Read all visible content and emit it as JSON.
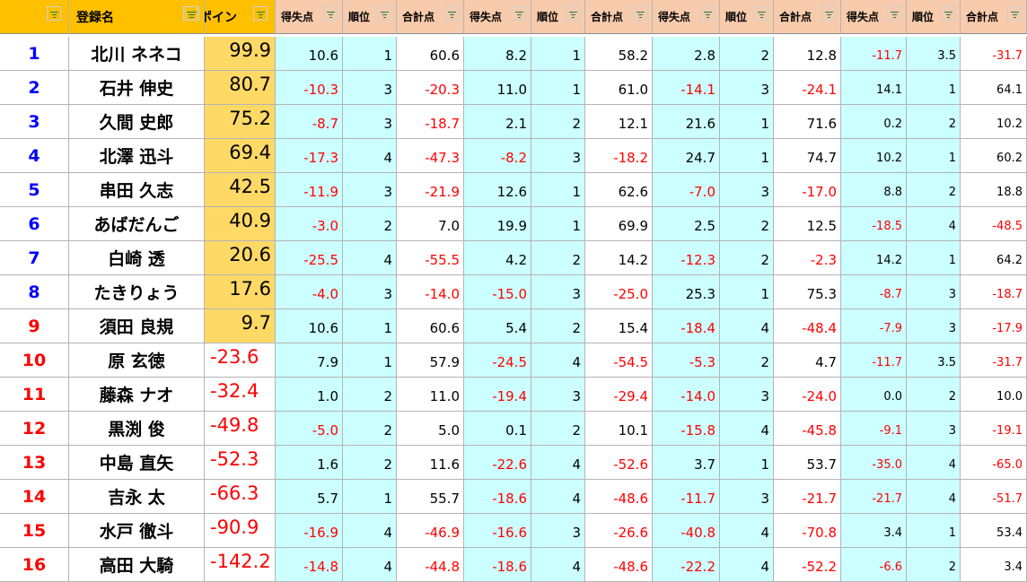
{
  "header": {
    "rank_col": "",
    "name_col": "登録名",
    "points_col": "ポイン",
    "round_cols": [
      "得失点",
      "順位",
      "合計点",
      "得失点",
      "順位",
      "合計点",
      "得失点",
      "順位",
      "合計点",
      "得失点",
      "順位",
      "合計点"
    ]
  },
  "colors": {
    "header_bg": "#f8cbad",
    "header_orange": "#ffc000",
    "points_bg": "#ffd966",
    "cyan_bg": "#ccffff",
    "negative": "#ff0000",
    "rank_blue": "#0000ff",
    "rank_red": "#ff0000"
  },
  "icons": {
    "filter": "filter-dropdown-icon"
  },
  "rows": [
    {
      "rank": "1",
      "name": "北川 ネネコ",
      "points": "99.9",
      "vals": [
        "10.6",
        "1",
        "60.6",
        "8.2",
        "1",
        "58.2",
        "2.8",
        "2",
        "12.8",
        "-11.7",
        "3.5",
        "-31.7"
      ]
    },
    {
      "rank": "2",
      "name": "石井 伸史",
      "points": "80.7",
      "vals": [
        "-10.3",
        "3",
        "-20.3",
        "11.0",
        "1",
        "61.0",
        "-14.1",
        "3",
        "-24.1",
        "14.1",
        "1",
        "64.1"
      ]
    },
    {
      "rank": "3",
      "name": "久間 史郎",
      "points": "75.2",
      "vals": [
        "-8.7",
        "3",
        "-18.7",
        "2.1",
        "2",
        "12.1",
        "21.6",
        "1",
        "71.6",
        "0.2",
        "2",
        "10.2"
      ]
    },
    {
      "rank": "4",
      "name": "北澤 迅斗",
      "points": "69.4",
      "vals": [
        "-17.3",
        "4",
        "-47.3",
        "-8.2",
        "3",
        "-18.2",
        "24.7",
        "1",
        "74.7",
        "10.2",
        "1",
        "60.2"
      ]
    },
    {
      "rank": "5",
      "name": "串田 久志",
      "points": "42.5",
      "vals": [
        "-11.9",
        "3",
        "-21.9",
        "12.6",
        "1",
        "62.6",
        "-7.0",
        "3",
        "-17.0",
        "8.8",
        "2",
        "18.8"
      ]
    },
    {
      "rank": "6",
      "name": "あばだんご",
      "points": "40.9",
      "vals": [
        "-3.0",
        "2",
        "7.0",
        "19.9",
        "1",
        "69.9",
        "2.5",
        "2",
        "12.5",
        "-18.5",
        "4",
        "-48.5"
      ]
    },
    {
      "rank": "7",
      "name": "白崎 透",
      "points": "20.6",
      "vals": [
        "-25.5",
        "4",
        "-55.5",
        "4.2",
        "2",
        "14.2",
        "-12.3",
        "2",
        "-2.3",
        "14.2",
        "1",
        "64.2"
      ]
    },
    {
      "rank": "8",
      "name": "たきりょう",
      "points": "17.6",
      "vals": [
        "-4.0",
        "3",
        "-14.0",
        "-15.0",
        "3",
        "-25.0",
        "25.3",
        "1",
        "75.3",
        "-8.7",
        "3",
        "-18.7"
      ]
    },
    {
      "rank": "9",
      "name": "須田 良規",
      "points": "9.7",
      "vals": [
        "10.6",
        "1",
        "60.6",
        "5.4",
        "2",
        "15.4",
        "-18.4",
        "4",
        "-48.4",
        "-7.9",
        "3",
        "-17.9"
      ]
    },
    {
      "rank": "10",
      "name": "原 玄徳",
      "points": "-23.6",
      "vals": [
        "7.9",
        "1",
        "57.9",
        "-24.5",
        "4",
        "-54.5",
        "-5.3",
        "2",
        "4.7",
        "-11.7",
        "3.5",
        "-31.7"
      ]
    },
    {
      "rank": "11",
      "name": "藤森 ナオ",
      "points": "-32.4",
      "vals": [
        "1.0",
        "2",
        "11.0",
        "-19.4",
        "3",
        "-29.4",
        "-14.0",
        "3",
        "-24.0",
        "0.0",
        "2",
        "10.0"
      ]
    },
    {
      "rank": "12",
      "name": "黒渕 俊",
      "points": "-49.8",
      "vals": [
        "-5.0",
        "2",
        "5.0",
        "0.1",
        "2",
        "10.1",
        "-15.8",
        "4",
        "-45.8",
        "-9.1",
        "3",
        "-19.1"
      ]
    },
    {
      "rank": "13",
      "name": "中島 直矢",
      "points": "-52.3",
      "vals": [
        "1.6",
        "2",
        "11.6",
        "-22.6",
        "4",
        "-52.6",
        "3.7",
        "1",
        "53.7",
        "-35.0",
        "4",
        "-65.0"
      ]
    },
    {
      "rank": "14",
      "name": "吉永 太",
      "points": "-66.3",
      "vals": [
        "5.7",
        "1",
        "55.7",
        "-18.6",
        "4",
        "-48.6",
        "-11.7",
        "3",
        "-21.7",
        "-21.7",
        "4",
        "-51.7"
      ]
    },
    {
      "rank": "15",
      "name": "水戸 徹斗",
      "points": "-90.9",
      "vals": [
        "-16.9",
        "4",
        "-46.9",
        "-16.6",
        "3",
        "-26.6",
        "-40.8",
        "4",
        "-70.8",
        "3.4",
        "1",
        "53.4"
      ]
    },
    {
      "rank": "16",
      "name": "高田 大騎",
      "points": "-142.2",
      "vals": [
        "-14.8",
        "4",
        "-44.8",
        "-18.6",
        "4",
        "-48.6",
        "-22.2",
        "4",
        "-52.2",
        "-6.6",
        "2",
        "3.4"
      ]
    }
  ]
}
